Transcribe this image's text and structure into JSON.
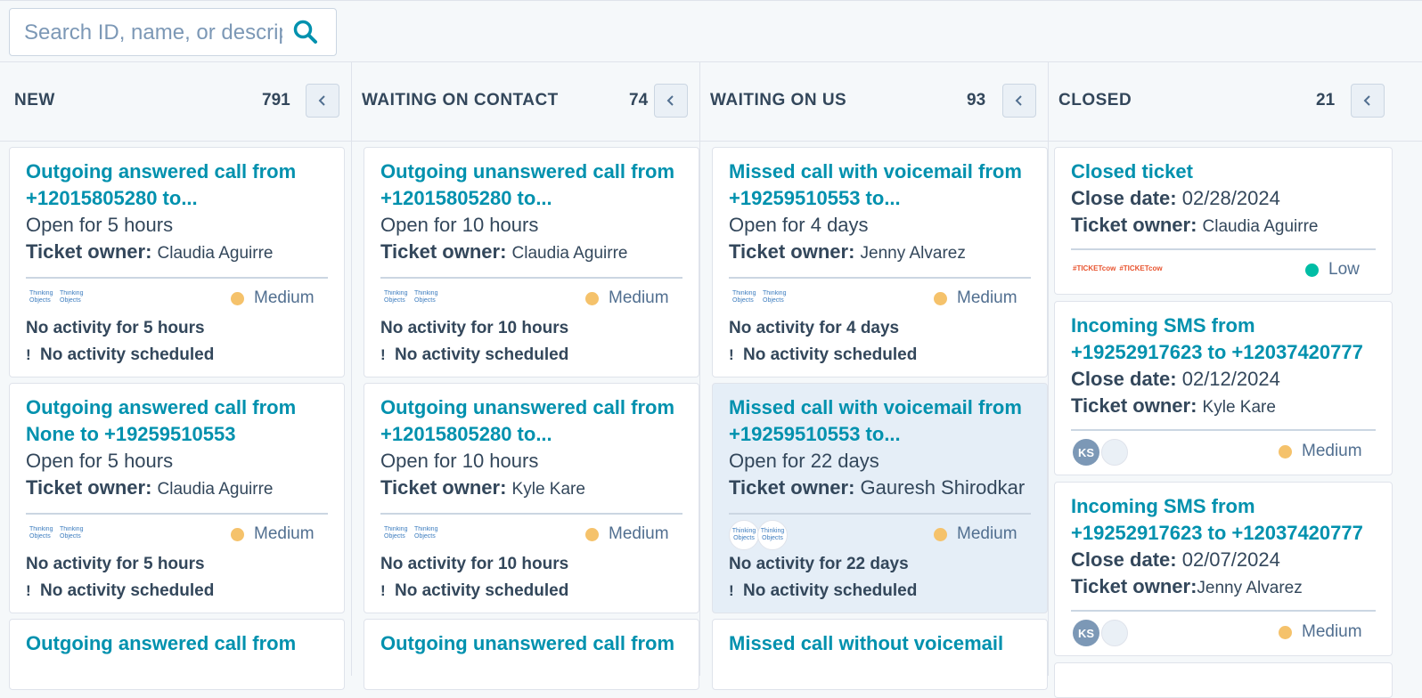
{
  "search": {
    "placeholder": "Search ID, name, or description"
  },
  "columns": [
    {
      "title": "NEW",
      "count": "791"
    },
    {
      "title": "WAITING ON CONTACT",
      "count": "74"
    },
    {
      "title": "WAITING ON US",
      "count": "93"
    },
    {
      "title": "CLOSED",
      "count": "21"
    }
  ],
  "labels": {
    "ticket_owner": "Ticket owner:",
    "close_date": "Close date:",
    "exclamation": "!",
    "logo_text": "Thinking Objects",
    "logo_ticket": "#TICKETcow"
  },
  "cards": {
    "new": [
      {
        "title1": "Outgoing answered call from",
        "title2": "+12015805280 to...",
        "open": "Open for 5 hours",
        "owner": "Claudia Aguirre",
        "priority": "Medium",
        "activity": "No activity for 5 hours",
        "scheduled": "No activity scheduled"
      },
      {
        "title1": "Outgoing answered call from",
        "title2": "None to +19259510553",
        "open": "Open for 5 hours",
        "owner": "Claudia Aguirre",
        "priority": "Medium",
        "activity": "No activity for 5 hours",
        "scheduled": "No activity scheduled"
      },
      {
        "title1": "Outgoing answered call from"
      }
    ],
    "waiting_contact": [
      {
        "title1": "Outgoing unanswered call from",
        "title2": "+12015805280 to...",
        "open": "Open for 10 hours",
        "owner": "Claudia Aguirre",
        "priority": "Medium",
        "activity": "No activity for 10 hours",
        "scheduled": "No activity scheduled"
      },
      {
        "title1": "Outgoing unanswered call from",
        "title2": "+12015805280 to...",
        "open": "Open for 10 hours",
        "owner": "Kyle Kare",
        "priority": "Medium",
        "activity": "No activity for 10 hours",
        "scheduled": "No activity scheduled"
      },
      {
        "title1": "Outgoing unanswered call from"
      }
    ],
    "waiting_us": [
      {
        "title1": "Missed call with voicemail from",
        "title2": "+19259510553 to...",
        "open": "Open for 4 days",
        "owner": "Jenny Alvarez",
        "priority": "Medium",
        "activity": "No activity for 4 days",
        "scheduled": "No activity scheduled"
      },
      {
        "title1": "Missed call with voicemail from",
        "title2": "+19259510553 to...",
        "open": "Open for 22 days",
        "owner": "Gauresh Shirodkar",
        "priority": "Medium",
        "activity": "No activity for 22 days",
        "scheduled": "No activity scheduled"
      },
      {
        "title1": "Missed call without voicemail"
      }
    ],
    "closed": [
      {
        "title1": "Closed ticket",
        "close_date": "02/28/2024",
        "owner": "Claudia Aguirre",
        "priority": "Low"
      },
      {
        "title1": "Incoming SMS from",
        "title2": "+19252917623 to +12037420777",
        "close_date": "02/12/2024",
        "owner": "Kyle Kare",
        "avatar": "KS",
        "priority": "Medium"
      },
      {
        "title1": "Incoming SMS from",
        "title2": "+19252917623 to +12037420777",
        "close_date": "02/07/2024",
        "owner": "Jenny Alvarez",
        "avatar": "KS",
        "priority": "Medium"
      }
    ]
  },
  "colors": {
    "link": "#0091ae",
    "medium": "#f5c26b",
    "low": "#00bda5",
    "text": "#33475b"
  }
}
